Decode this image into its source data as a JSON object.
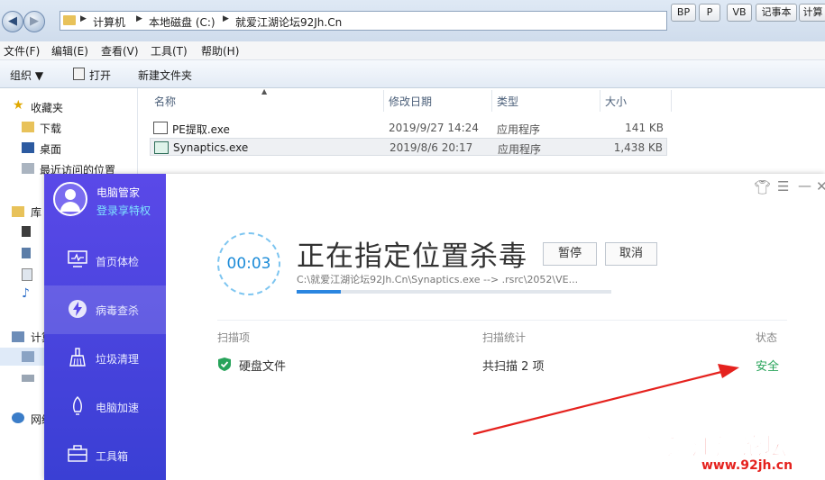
{
  "explorer": {
    "address": [
      "计算机",
      "本地磁盘 (C:)",
      "就爱江湖论坛92Jh.Cn"
    ],
    "quick_buttons": [
      "BP",
      "P",
      "VB",
      "记事本",
      "计算"
    ],
    "menu": [
      "文件(F)",
      "编辑(E)",
      "查看(V)",
      "工具(T)",
      "帮助(H)"
    ],
    "toolbar": {
      "organize": "组织 ▼",
      "open": "打开",
      "new_folder": "新建文件夹"
    },
    "nav": {
      "favorites": "收藏夹",
      "downloads": "下载",
      "desktop": "桌面",
      "recent": "最近访问的位置",
      "library": "库",
      "computer": "计算",
      "network": "网络"
    },
    "columns": {
      "name": "名称",
      "date": "修改日期",
      "type": "类型",
      "size": "大小"
    },
    "files": [
      {
        "name": "PE提取.exe",
        "date": "2019/9/27 14:24",
        "type": "应用程序",
        "size": "141 KB"
      },
      {
        "name": "Synaptics.exe",
        "date": "2019/8/6 20:17",
        "type": "应用程序",
        "size": "1,438 KB"
      }
    ]
  },
  "antivirus": {
    "brand": "电脑管家",
    "login": "登录享特权",
    "sidebar": [
      "首页体检",
      "病毒查杀",
      "垃圾清理",
      "电脑加速",
      "工具箱"
    ],
    "active_index": 1,
    "timer": "00:03",
    "title": "正在指定位置杀毒",
    "pause": "暂停",
    "cancel": "取消",
    "path": "C:\\就爱江湖论坛92Jh.Cn\\Synaptics.exe --> .rsrc\\2052\\VE...",
    "progress": 0.14,
    "headers": {
      "item": "扫描项",
      "stats": "扫描统计",
      "status": "状态"
    },
    "row": {
      "item": "硬盘文件",
      "stats": "共扫描 2 项",
      "status": "安全"
    },
    "accent": "#2a86e0",
    "safe_color": "#27a35a"
  },
  "watermark": {
    "cn": "就爱江湖论坛",
    "url": "www.92jh.cn"
  }
}
